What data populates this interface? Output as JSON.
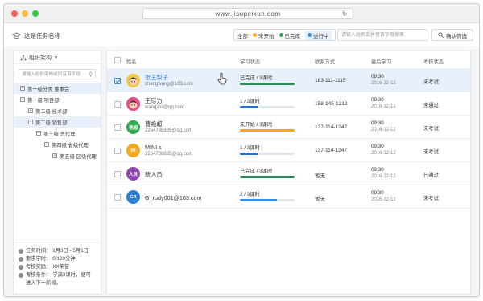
{
  "browser": {
    "url": "www.jisupeixun.com"
  },
  "toolbar": {
    "task_name": "这是任务名称",
    "filters": [
      {
        "label": "全部",
        "dot": ""
      },
      {
        "label": "未开始",
        "dot": "#f5a623"
      },
      {
        "label": "已完成",
        "dot": "#2fa84f"
      },
      {
        "label": "进行中",
        "dot": "#3b8fe0"
      }
    ],
    "search_placeholder": "请输入姓名或拼音首字母搜索",
    "confirm_label": "确认筛选"
  },
  "sidebar": {
    "header": "组织架构",
    "search_placeholder": "请输入组织架构或拼音首字母",
    "tree": [
      {
        "label": "第一级分类 董事会",
        "toggle": "+"
      },
      {
        "label": "第一级 项目部",
        "toggle": "−"
      },
      {
        "label": "第二级 技术部",
        "toggle": "+"
      },
      {
        "label": "第二级 销售部",
        "toggle": "−"
      },
      {
        "label": "第三级 总代理",
        "toggle": "−"
      },
      {
        "label": "第四级 省级代理",
        "toggle": "−"
      },
      {
        "label": "第五级 区级代理",
        "toggle": "+"
      }
    ],
    "info": [
      {
        "text": "任务时间：  1月3日 - 5月1日"
      },
      {
        "text": "要求学时：  0/120分钟"
      },
      {
        "text": "考核奖励：  XX荣誉"
      },
      {
        "text": "考核条件：  学满3课时，便可进入下一阶段。"
      }
    ]
  },
  "table": {
    "headers": [
      "姓名",
      "学习状态",
      "联系方式",
      "最后学习",
      "考核状态"
    ],
    "rows": [
      {
        "avatar_text": "",
        "avatar_color": "#f0c94b",
        "name": "张王梨子",
        "email": "zhangwang@163.com",
        "status": "已完成 / 3课时",
        "progress": 1.0,
        "bar_color": "#2e8b57",
        "phone": "183-111-1115",
        "time": "09:30",
        "date": "2016-12-12",
        "exam": "未考试"
      },
      {
        "avatar_text": "",
        "avatar_color": "#e84e8a",
        "name": "王尽力",
        "email": "wangjinli@qq.com",
        "status": "1 / 3课时",
        "progress": 0.33,
        "bar_color": "#2a6fcf",
        "phone": "158-145-1212",
        "time": "09:30",
        "date": "2016-12-12",
        "exam": "未通过"
      },
      {
        "avatar_text": "艳超",
        "avatar_color": "#2fa84f",
        "name": "曹艳超",
        "email": "2264788885@qq.com",
        "status": "未开始 / 3课时",
        "progress": 1.0,
        "bar_color": "#f5a623",
        "phone": "137-114-1247",
        "time": "09:30",
        "date": "2016-12-12",
        "exam": "未考试"
      },
      {
        "avatar_text": "MI",
        "avatar_color": "#f5a623",
        "name": "MINI s",
        "email": "2264788885@qq.com",
        "status": "1 / 3课时",
        "progress": 0.33,
        "bar_color": "#2a6fcf",
        "phone": "137-114-1247",
        "time": "09:30",
        "date": "2016-12-12",
        "exam": "未考试"
      },
      {
        "avatar_text": "人员",
        "avatar_color": "#8e44ad",
        "name": "新人员",
        "email": "",
        "status": "已完成 / 3课时",
        "progress": 1.0,
        "bar_color": "#2e8b57",
        "phone": "暂无",
        "time": "09:30",
        "date": "2016-12-12",
        "exam": "已通过"
      },
      {
        "avatar_text": "GR",
        "avatar_color": "#2a7fd6",
        "name": "G_rudy001@163.com",
        "email": "",
        "status": "2 / 3课时",
        "progress": 0.67,
        "bar_color": "#3b8fe0",
        "phone": "暂无",
        "time": "09:30",
        "date": "2016-12-12",
        "exam": "未考试"
      }
    ]
  }
}
